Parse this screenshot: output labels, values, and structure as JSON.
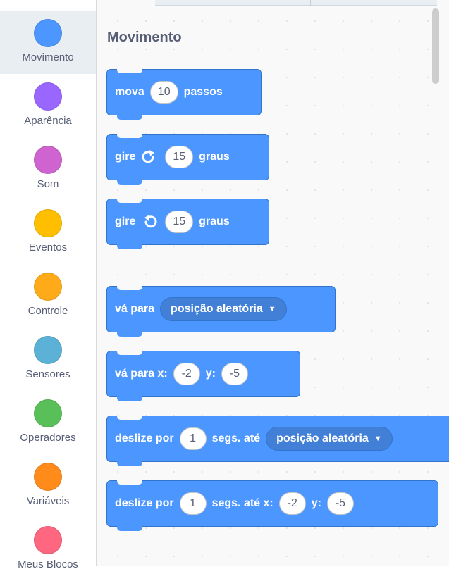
{
  "categories": [
    {
      "label": "Movimento",
      "color": "#4c97ff",
      "selected": true
    },
    {
      "label": "Aparência",
      "color": "#9966ff"
    },
    {
      "label": "Som",
      "color": "#cf63cf"
    },
    {
      "label": "Eventos",
      "color": "#ffbf00"
    },
    {
      "label": "Controle",
      "color": "#ffab19"
    },
    {
      "label": "Sensores",
      "color": "#5cb1d6"
    },
    {
      "label": "Operadores",
      "color": "#59c059"
    },
    {
      "label": "Variáveis",
      "color": "#ff8c1a"
    },
    {
      "label": "Meus Blocos",
      "color": "#ff6680"
    }
  ],
  "palette": {
    "title": "Movimento",
    "blocks": {
      "move": {
        "text1": "mova",
        "steps": "10",
        "text2": "passos"
      },
      "turn_right": {
        "text1": "gire",
        "icon": "rotate-clockwise-icon",
        "degrees": "15",
        "text2": "graus"
      },
      "turn_left": {
        "text1": "gire",
        "icon": "rotate-counterclockwise-icon",
        "degrees": "15",
        "text2": "graus"
      },
      "goto": {
        "text1": "vá para",
        "dropdown": "posição aleatória"
      },
      "goto_xy": {
        "text1": "vá para x:",
        "x": "-2",
        "text2": "y:",
        "y": "-5"
      },
      "glide_to": {
        "text1": "deslize por",
        "secs": "1",
        "text2": "segs. até",
        "dropdown": "posição aleatória"
      },
      "glide_xy": {
        "text1": "deslize por",
        "secs": "1",
        "text2": "segs. até x:",
        "x": "-2",
        "text3": "y:",
        "y": "-5"
      }
    }
  },
  "colors": {
    "motion": "#4c97ff",
    "motion_dark": "#3373cc",
    "dropdown": "#4280d7",
    "label_text": "#575e75",
    "selected_bg": "#e9eef2"
  }
}
